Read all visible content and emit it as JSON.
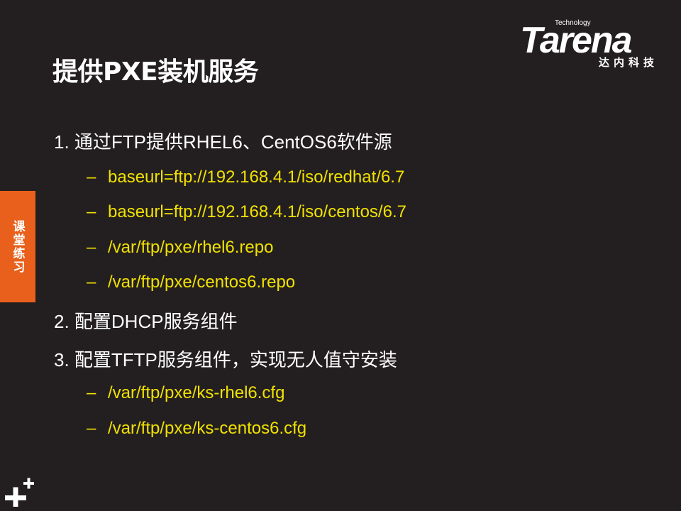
{
  "logo": {
    "technology": "Technology",
    "word": "Tarena",
    "chinese": "达内科技"
  },
  "title": "提供PXE装机服务",
  "side_tab": "课堂练习",
  "items": [
    {
      "label": "1. 通过FTP提供RHEL6、CentOS6软件源",
      "subs": [
        "baseurl=ftp://192.168.4.1/iso/redhat/6.7",
        "baseurl=ftp://192.168.4.1/iso/centos/6.7",
        "/var/ftp/pxe/rhel6.repo",
        "/var/ftp/pxe/centos6.repo"
      ]
    },
    {
      "label": "2. 配置DHCP服务组件",
      "subs": []
    },
    {
      "label": "3. 配置TFTP服务组件，实现无人值守安装",
      "subs": [
        "/var/ftp/pxe/ks-rhel6.cfg",
        "/var/ftp/pxe/ks-centos6.cfg"
      ]
    }
  ],
  "dash": "–",
  "colors": {
    "background": "#231f20",
    "accent_tab": "#e8601c",
    "sub_text": "#f1e100",
    "main_text": "#ffffff"
  }
}
